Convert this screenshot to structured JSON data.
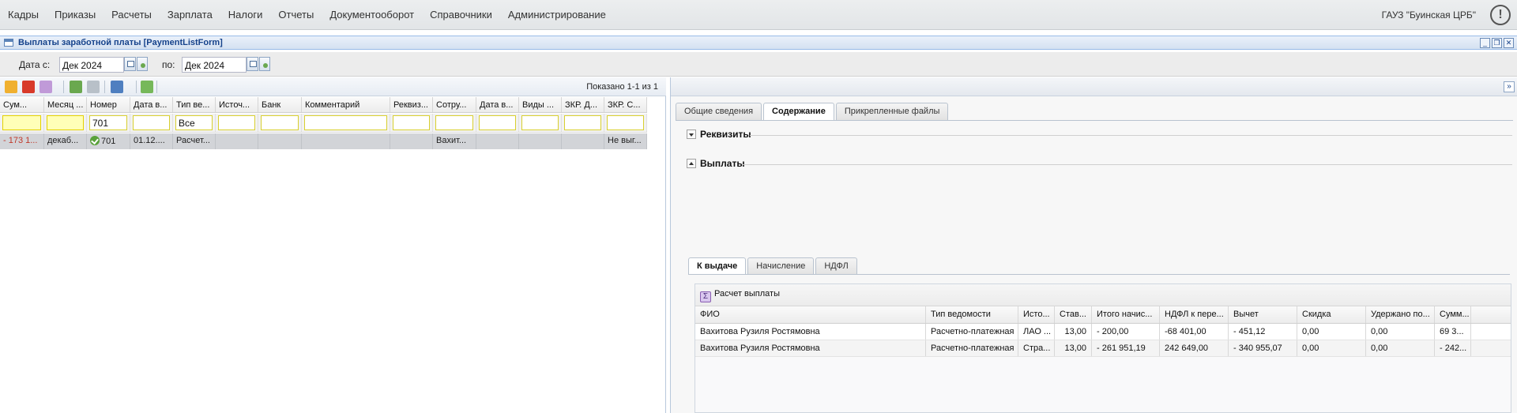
{
  "menu": [
    "Кадры",
    "Приказы",
    "Расчеты",
    "Зарплата",
    "Налоги",
    "Отчеты",
    "Документооборот",
    "Справочники",
    "Администрирование"
  ],
  "org": "ГАУЗ \"Буинская ЦРБ\"",
  "alert_glyph": "!",
  "window": {
    "title": "Выплаты заработной платы [PaymentListForm]"
  },
  "dates": {
    "from_label": "Дата с:",
    "from_value": "Дек 2024",
    "to_label": "по:",
    "to_value": "Дек 2024"
  },
  "grid": {
    "shown": "Показано 1-1 из 1",
    "columns": [
      "Сум...",
      "Месяц ...",
      "Номер",
      "Дата в...",
      "Тип ве...",
      "Источ...",
      "Банк",
      "Комментарий",
      "Реквиз...",
      "Сотру...",
      "Дата в...",
      "Виды ...",
      "ЗКР. Д...",
      "ЗКР. С..."
    ],
    "filter": {
      "number": "701",
      "type": "Все"
    },
    "row": [
      "- 173 1...",
      "декаб...",
      "701",
      "01.12....",
      "Расчет...",
      "",
      "",
      "",
      "",
      "Вахит...",
      "",
      "",
      "",
      "Не выг..."
    ]
  },
  "right": {
    "tabs": [
      "Общие сведения",
      "Содержание",
      "Прикрепленные файлы"
    ],
    "sections": {
      "requisites": "Реквизиты",
      "payments": "Выплаты"
    },
    "subtabs": [
      "К выдаче",
      "Начисление",
      "НДФЛ"
    ],
    "calc_button": "Расчет выплаты",
    "columns": [
      "ФИО",
      "Тип ведомости",
      "Исто...",
      "Став...",
      "Итого начис...",
      "НДФЛ к пере...",
      "Вычет",
      "Скидка",
      "Удержано по...",
      "Сумм..."
    ],
    "rows": [
      [
        "Вахитова Рузиля Ростямовна",
        "Расчетно-платежная",
        "ЛАО ...",
        "13,00",
        "- 200,00",
        "-68 401,00",
        "- 451,12",
        "0,00",
        "0,00",
        "69 3..."
      ],
      [
        "Вахитова Рузиля Ростямовна",
        "Расчетно-платежная",
        "Стра...",
        "13,00",
        "- 261 951,19",
        "242 649,00",
        "- 340 955,07",
        "0,00",
        "0,00",
        "- 242..."
      ]
    ]
  }
}
